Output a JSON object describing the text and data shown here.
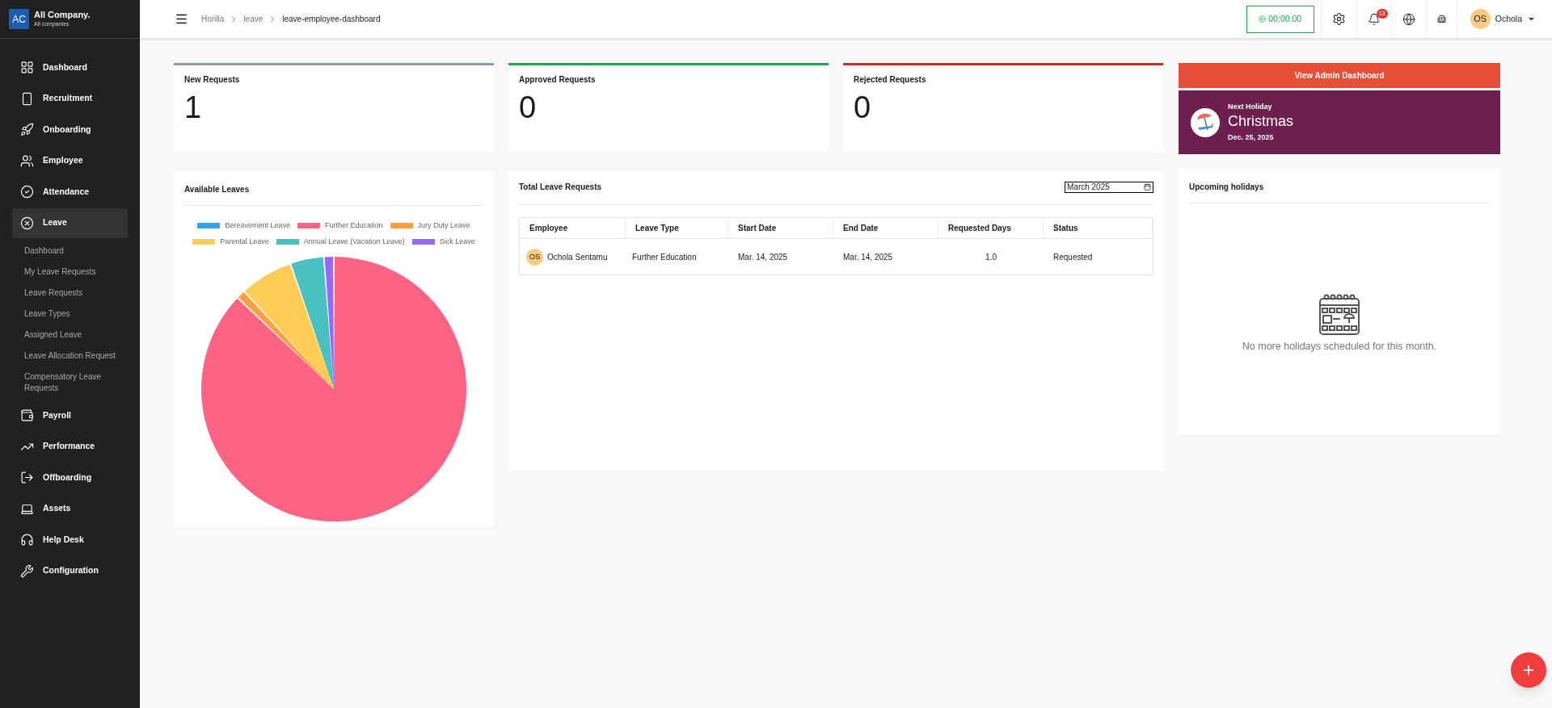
{
  "company": {
    "logo": "AC",
    "name": "All Company.",
    "subtitle": "All companies"
  },
  "sidebar": {
    "items": [
      {
        "label": "Dashboard",
        "selected": false
      },
      {
        "label": "Recruitment",
        "selected": false
      },
      {
        "label": "Onboarding",
        "selected": false
      },
      {
        "label": "Employee",
        "selected": false
      },
      {
        "label": "Attendance",
        "selected": false
      },
      {
        "label": "Leave",
        "selected": true,
        "children": [
          {
            "label": "Dashboard",
            "selected": false
          },
          {
            "label": "My Leave Requests",
            "selected": false
          },
          {
            "label": "Leave Requests",
            "selected": false
          },
          {
            "label": "Leave Types",
            "selected": false
          },
          {
            "label": "Assigned Leave",
            "selected": false
          },
          {
            "label": "Leave Allocation Request",
            "selected": false
          },
          {
            "label": "Compensatory Leave Requests",
            "selected": false
          }
        ]
      },
      {
        "label": "Payroll",
        "selected": false
      },
      {
        "label": "Performance",
        "selected": false
      },
      {
        "label": "Offboarding",
        "selected": false
      },
      {
        "label": "Assets",
        "selected": false
      },
      {
        "label": "Help Desk",
        "selected": false
      },
      {
        "label": "Configuration",
        "selected": false
      }
    ]
  },
  "breadcrumb": [
    "Horilla",
    "leave",
    "leave-employee-dashboard"
  ],
  "topbar": {
    "timer": "00:00:00",
    "notifications": "13",
    "user": {
      "initials": "OS",
      "name": "Ochola"
    }
  },
  "stat_cards": [
    {
      "title": "New Requests",
      "value": "1",
      "color": "#8e99ab"
    },
    {
      "title": "Approved Requests",
      "value": "0",
      "color": "#1ba64f"
    },
    {
      "title": "Rejected Requests",
      "value": "0",
      "color": "#cf2e28"
    }
  ],
  "admin_button": "View Admin Dashboard",
  "next_holiday": {
    "label": "Next Holiday",
    "name": "Christmas",
    "date": "Dec. 25, 2025"
  },
  "available_leaves": {
    "title": "Available Leaves",
    "legend": [
      {
        "label": "Bereavement Leave",
        "color": "#36a2eb"
      },
      {
        "label": "Further Education",
        "color": "#ff6384"
      },
      {
        "label": "Jury Duty Leave",
        "color": "#ff9f40"
      },
      {
        "label": "Parental Leave",
        "color": "#ffcd56"
      },
      {
        "label": "Annual Leave (Vacation Leave)",
        "color": "#4bc0c0"
      },
      {
        "label": "Sick Leave",
        "color": "#9966ff"
      }
    ]
  },
  "total_leave_requests": {
    "title": "Total Leave Requests",
    "month": "March 2025",
    "columns": [
      "Employee",
      "Leave Type",
      "Start Date",
      "End Date",
      "Requested Days",
      "Status"
    ],
    "rows": [
      {
        "initials": "OS",
        "employee": "Ochola Sentamu",
        "leave_type": "Further Education",
        "start_date": "Mar. 14, 2025",
        "end_date": "Mar. 14, 2025",
        "requested_days": "1.0",
        "status": "Requested"
      }
    ]
  },
  "upcoming_holidays": {
    "title": "Upcoming holidays",
    "empty_message": "No more holidays scheduled for this month."
  },
  "fab": "+"
}
